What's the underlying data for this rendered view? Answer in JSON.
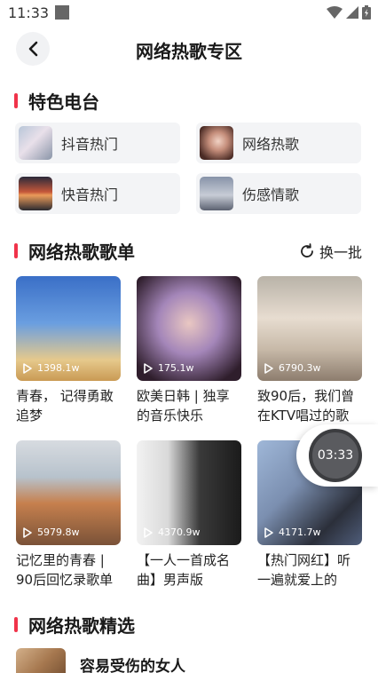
{
  "status": {
    "time": "11:33"
  },
  "header": {
    "title": "网络热歌专区"
  },
  "featured": {
    "title": "特色电台",
    "items": [
      {
        "label": "抖音热门"
      },
      {
        "label": "网络热歌"
      },
      {
        "label": "快音热门"
      },
      {
        "label": "伤感情歌"
      }
    ]
  },
  "playlists": {
    "title": "网络热歌歌单",
    "refresh_label": "换一批",
    "items": [
      {
        "plays": "1398.1w",
        "title": "青春， 记得勇敢追梦"
      },
      {
        "plays": "175.1w",
        "title": "欧美日韩 | 独享的音乐快乐"
      },
      {
        "plays": "6790.3w",
        "title": "致90后，我们曾在KTV唱过的歌"
      },
      {
        "plays": "5979.8w",
        "title": "记忆里的青春 | 90后回忆录歌单"
      },
      {
        "plays": "4370.9w",
        "title": "【一人一首成名曲】男声版"
      },
      {
        "plays": "4171.7w",
        "title": "【热门网红】听一遍就爱上的网..."
      }
    ]
  },
  "timer": {
    "value": "03:33"
  },
  "picks": {
    "title": "网络热歌精选",
    "items": [
      {
        "title": "容易受伤的女人"
      }
    ]
  },
  "colors": {
    "accent": "#f0334a",
    "card_bg": "#f3f4f6"
  }
}
